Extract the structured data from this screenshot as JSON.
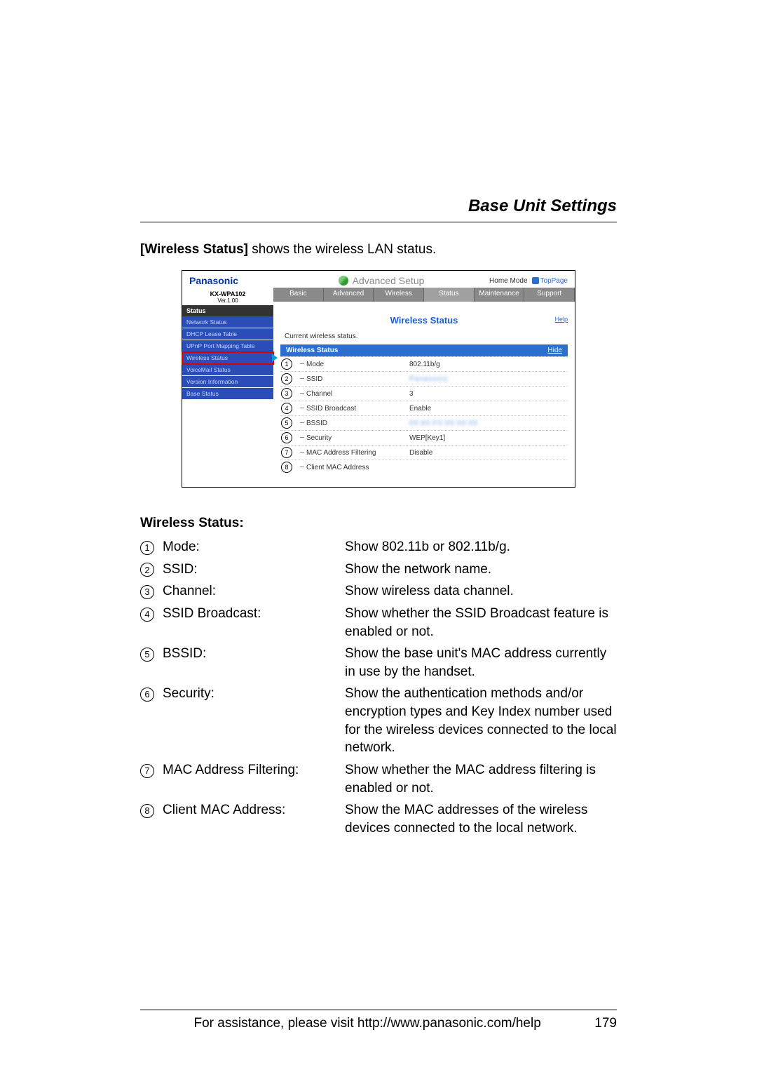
{
  "page_title": "Base Unit Settings",
  "intro_bold": "[Wireless Status]",
  "intro_rest": " shows the wireless LAN status.",
  "shot": {
    "brand": "Panasonic",
    "setup_label": "Advanced Setup",
    "home_mode_label": "Home Mode",
    "toppage_label": "TopPage",
    "model": "KX-WPA102",
    "version": "Ver.1.00",
    "tabs": [
      "Basic",
      "Advanced",
      "Wireless",
      "Status",
      "Maintenance",
      "Support"
    ],
    "active_tab": "Status",
    "sidebar_header": "Status",
    "sidebar_items": [
      "Network Status",
      "DHCP Lease Table",
      "UPnP Port Mapping Table",
      "Wireless Status",
      "VoiceMail Status",
      "Version Information",
      "Base Status"
    ],
    "sidebar_active_index": 3,
    "content_title": "Wireless Status",
    "help_label": "Help",
    "subtitle": "Current wireless status.",
    "status_header": "Wireless Status",
    "hide_label": "Hide",
    "rows": [
      {
        "n": "1",
        "label": "Mode",
        "value": "802.11b/g",
        "blur": false
      },
      {
        "n": "2",
        "label": "SSID",
        "value": "Panasonic",
        "blur": true
      },
      {
        "n": "3",
        "label": "Channel",
        "value": "3",
        "blur": false
      },
      {
        "n": "4",
        "label": "SSID Broadcast",
        "value": "Enable",
        "blur": false
      },
      {
        "n": "5",
        "label": "BSSID",
        "value": "00:80:F0:00:00:00",
        "blur": true
      },
      {
        "n": "6",
        "label": "Security",
        "value": "WEP[Key1]",
        "blur": false
      },
      {
        "n": "7",
        "label": "MAC Address Filtering",
        "value": "Disable",
        "blur": false
      },
      {
        "n": "8",
        "label": "Client MAC Address",
        "value": "",
        "blur": false
      }
    ]
  },
  "defs_title": "Wireless Status:",
  "defs": [
    {
      "n": "1",
      "label": "Mode:",
      "desc": "Show 802.11b or 802.11b/g."
    },
    {
      "n": "2",
      "label": "SSID:",
      "desc": "Show the network name."
    },
    {
      "n": "3",
      "label": "Channel:",
      "desc": "Show wireless data channel."
    },
    {
      "n": "4",
      "label": "SSID Broadcast:",
      "desc": "Show whether the SSID Broadcast feature is enabled or not."
    },
    {
      "n": "5",
      "label": "BSSID:",
      "desc": "Show the base unit's MAC address currently in use by the handset."
    },
    {
      "n": "6",
      "label": "Security:",
      "desc": "Show the authentication methods and/or encryption types and Key Index number used for the wireless devices connected to the local network."
    },
    {
      "n": "7",
      "label": "MAC Address Filtering:",
      "desc": "Show whether the MAC address filtering is enabled or not."
    },
    {
      "n": "8",
      "label": "Client MAC Address:",
      "desc": "Show the MAC addresses of the wireless devices connected to the local network."
    }
  ],
  "footer_text": "For assistance, please visit http://www.panasonic.com/help",
  "page_number": "179"
}
